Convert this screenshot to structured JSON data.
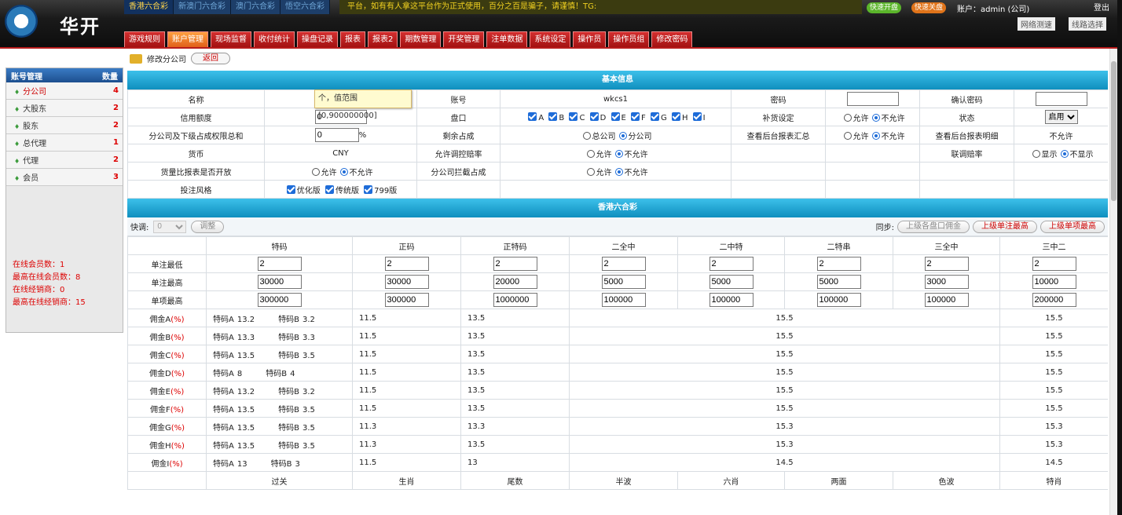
{
  "header": {
    "logo_text": "华开",
    "game_tabs": [
      "香港六合彩",
      "新澳门六合彩",
      "澳门六合彩",
      "悟空六合彩"
    ],
    "marquee": "平台，如有有人拿这平台作为正式使用，百分之百是骗子，请谨慎！TG:",
    "pill_a": "快速开盘",
    "pill_b": "快速关盘",
    "account": "账户：admin (公司)",
    "logout": "登出",
    "net_check": "网络测速",
    "line_select": "线路选择"
  },
  "menu": [
    "游戏规则",
    "账户管理",
    "现场监督",
    "收付统计",
    "操盘记录",
    "报表",
    "报表2",
    "期数管理",
    "开奖管理",
    "注单数据",
    "系统设定",
    "操作员",
    "操作员组",
    "修改密码"
  ],
  "sidebar": {
    "title": "账号管理",
    "count_label": "数量",
    "items": [
      {
        "label": "分公司",
        "count": "4"
      },
      {
        "label": "大股东",
        "count": "2"
      },
      {
        "label": "股东",
        "count": "2"
      },
      {
        "label": "总代理",
        "count": "1"
      },
      {
        "label": "代理",
        "count": "2"
      },
      {
        "label": "会员",
        "count": "3"
      }
    ],
    "stats": [
      "在线会员数：1",
      "最高在线会员数：8",
      "在线经销商：0",
      "最高在线经销商：15"
    ]
  },
  "crumb": {
    "title": "修改分公司",
    "back": "返回"
  },
  "tooltip": "个，值范围[0,900000000]",
  "basic": {
    "title": "基本信息",
    "r1": {
      "l1": "名称",
      "l2": "账号",
      "v2": "wkcs1",
      "l3": "密码",
      "l4": "确认密码"
    },
    "r2": {
      "l1": "信用额度",
      "v1": "0",
      "l2": "盘口",
      "plates": [
        "A",
        "B",
        "C",
        "D",
        "E",
        "F",
        "G",
        "H",
        "I"
      ],
      "l3": "补货设定",
      "opt_allow": "允许",
      "opt_deny": "不允许",
      "l4": "状态",
      "status": "启用"
    },
    "r3": {
      "l1": "分公司及下级占成权限总和",
      "v1": "0",
      "unit": "%",
      "l2": "剩余占成",
      "o1": "总公司",
      "o2": "分公司",
      "l3": "查看后台报表汇总",
      "l4": "查看后台报表明细",
      "v4": "不允许"
    },
    "r4": {
      "l1": "货币",
      "v1": "CNY",
      "l2": "允许调控赔率",
      "l4": "联调赔率",
      "show": "显示",
      "hide": "不显示"
    },
    "r5": {
      "l1": "货量比报表是否开放",
      "l2": "分公司拦截占成"
    },
    "r6": {
      "l1": "投注风格",
      "styles": [
        "优化版",
        "传统版",
        "799版"
      ]
    }
  },
  "lottery": {
    "title": "香港六合彩",
    "quick_label": "快调:",
    "quick_value": "0",
    "adjust": "调整",
    "sync_label": "同步:",
    "btn_commission": "上级各盘口佣金",
    "btn_single_max": "上级单注最高",
    "btn_item_max": "上级单项最高",
    "cols": [
      "特码",
      "正码",
      "正特码",
      "二全中",
      "二中特",
      "二特串",
      "三全中",
      "三中二"
    ],
    "limit_rows": [
      {
        "label": "单注最低",
        "vals": [
          "2",
          "2",
          "2",
          "2",
          "2",
          "2",
          "2",
          "2"
        ]
      },
      {
        "label": "单注最高",
        "vals": [
          "30000",
          "30000",
          "20000",
          "5000",
          "5000",
          "5000",
          "3000",
          "10000"
        ]
      },
      {
        "label": "单项最高",
        "vals": [
          "300000",
          "300000",
          "1000000",
          "100000",
          "100000",
          "100000",
          "100000",
          "200000"
        ]
      }
    ],
    "pct_sign": "(%)",
    "tmA": "特码A",
    "tmB": "特码B",
    "commission_rows": [
      {
        "label": "佣金A",
        "a": "13.2",
        "b": "3.2",
        "c1": "11.5",
        "c2": "13.5",
        "c3": "15.5",
        "c4": "15.5"
      },
      {
        "label": "佣金B",
        "a": "13.3",
        "b": "3.3",
        "c1": "11.5",
        "c2": "13.5",
        "c3": "15.5",
        "c4": "15.5"
      },
      {
        "label": "佣金C",
        "a": "13.5",
        "b": "3.5",
        "c1": "11.5",
        "c2": "13.5",
        "c3": "15.5",
        "c4": "15.5"
      },
      {
        "label": "佣金D",
        "a": "8",
        "b": "4",
        "c1": "11.5",
        "c2": "13.5",
        "c3": "15.5",
        "c4": "15.5"
      },
      {
        "label": "佣金E",
        "a": "13.2",
        "b": "3.2",
        "c1": "11.5",
        "c2": "13.5",
        "c3": "15.5",
        "c4": "15.5"
      },
      {
        "label": "佣金F",
        "a": "13.5",
        "b": "3.5",
        "c1": "11.5",
        "c2": "13.5",
        "c3": "15.5",
        "c4": "15.5"
      },
      {
        "label": "佣金G",
        "a": "13.5",
        "b": "3.5",
        "c1": "11.3",
        "c2": "13.3",
        "c3": "15.3",
        "c4": "15.3"
      },
      {
        "label": "佣金H",
        "a": "13.5",
        "b": "3.5",
        "c1": "11.3",
        "c2": "13.5",
        "c3": "15.3",
        "c4": "15.3"
      },
      {
        "label": "佣金I",
        "a": "13",
        "b": "3",
        "c1": "11.5",
        "c2": "13",
        "c3": "14.5",
        "c4": "14.5"
      }
    ],
    "cols2": [
      "过关",
      "生肖",
      "尾数",
      "半波",
      "六肖",
      "两面",
      "色波",
      "特肖"
    ]
  }
}
